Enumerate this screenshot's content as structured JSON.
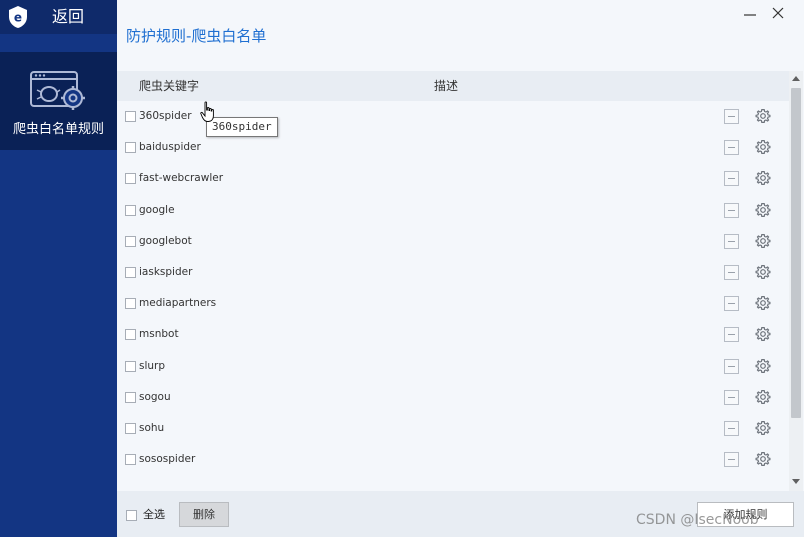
{
  "sidebar": {
    "back_label": "返回",
    "nav_items": [
      {
        "label": "爬虫白名单规则",
        "icon": "browser-bug-gear-icon"
      }
    ]
  },
  "window": {
    "title": "防护规则-爬虫白名单",
    "minimize_icon": "minimize-icon",
    "close_icon": "close-icon"
  },
  "table": {
    "columns": [
      "爬虫关键字",
      "描述"
    ],
    "rows": [
      {
        "keyword": "360spider",
        "description": ""
      },
      {
        "keyword": "baiduspider",
        "description": ""
      },
      {
        "keyword": "fast-webcrawler",
        "description": ""
      },
      {
        "keyword": "google",
        "description": ""
      },
      {
        "keyword": "googlebot",
        "description": ""
      },
      {
        "keyword": "iaskspider",
        "description": ""
      },
      {
        "keyword": "mediapartners",
        "description": ""
      },
      {
        "keyword": "msnbot",
        "description": ""
      },
      {
        "keyword": "slurp",
        "description": ""
      },
      {
        "keyword": "sogou",
        "description": ""
      },
      {
        "keyword": "sohu",
        "description": ""
      },
      {
        "keyword": "sosospider",
        "description": ""
      }
    ]
  },
  "tooltip": {
    "text": "360spider"
  },
  "footer": {
    "select_all_label": "全选",
    "delete_label": "删除",
    "add_rule_label": "添加规则"
  },
  "watermark": "CSDN @IsecNoob",
  "colors": {
    "sidebar": "#133583",
    "sidebar_active": "#0a2156",
    "accent": "#1f6fd1",
    "content_bg": "#f4f7fb"
  }
}
